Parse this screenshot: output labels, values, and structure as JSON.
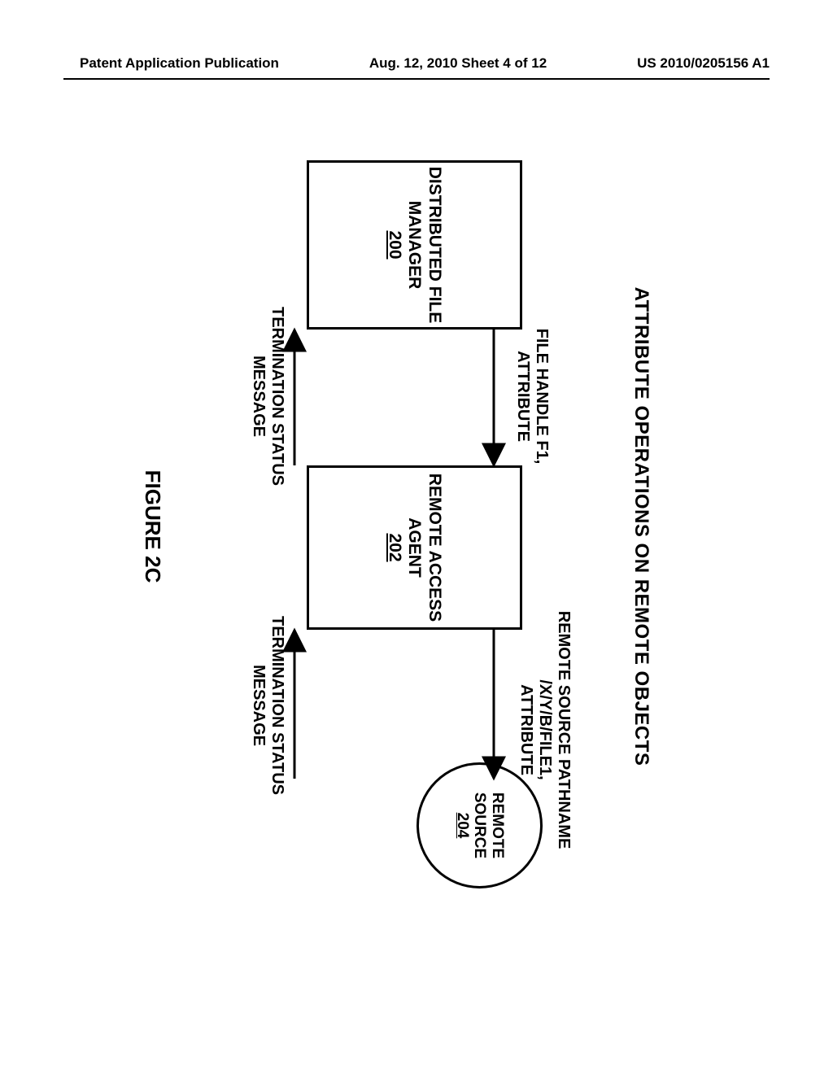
{
  "header": {
    "left": "Patent Application Publication",
    "center": "Aug. 12, 2010  Sheet 4 of 12",
    "right": "US 2010/0205156 A1"
  },
  "diagram": {
    "title": "ATTRIBUTE OPERATIONS ON REMOTE OBJECTS",
    "nodes": {
      "dfm": {
        "label": "DISTRIBUTED FILE MANAGER",
        "ref": "200"
      },
      "raa": {
        "label": "REMOTE ACCESS AGENT",
        "ref": "202"
      },
      "rs": {
        "label": "REMOTE SOURCE",
        "ref": "204"
      }
    },
    "arrows": {
      "dfm_to_raa_top": {
        "l1": "FILE HANDLE F1,",
        "l2": "ATTRIBUTE"
      },
      "raa_to_rs_top": {
        "l1": "REMOTE SOURCE PATHNAME",
        "l2": "/X/Y/B/FILE1,",
        "l3": "ATTRIBUTE"
      },
      "raa_to_dfm_bottom": {
        "l1": "TERMINATION STATUS",
        "l2": "MESSAGE"
      },
      "rs_to_raa_bottom": {
        "l1": "TERMINATION STATUS",
        "l2": "MESSAGE"
      }
    },
    "figure_label": "FIGURE 2C"
  }
}
